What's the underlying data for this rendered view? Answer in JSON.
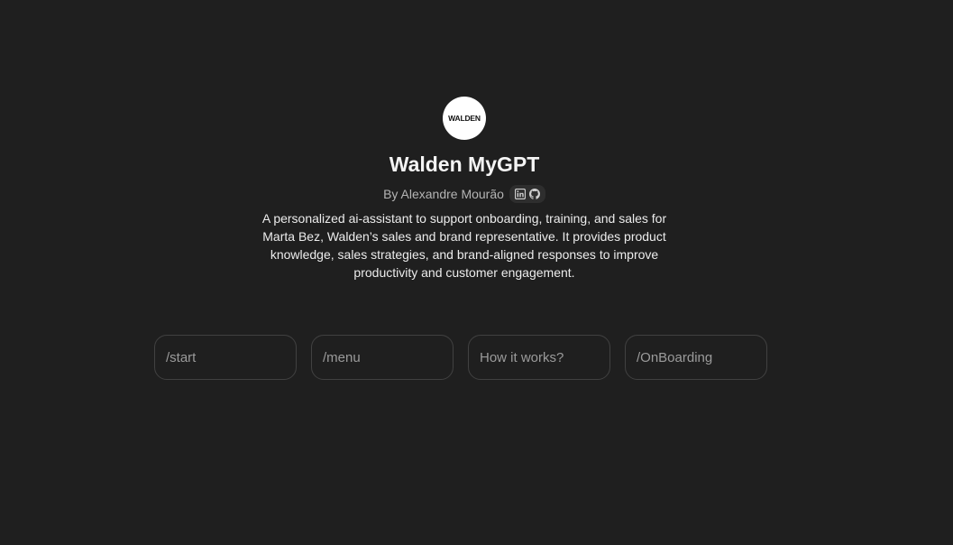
{
  "gpt": {
    "logo_text": "WALDEN",
    "title": "Walden MyGPT",
    "byline": "By Alexandre Mourão",
    "socials": [
      "linkedin-icon",
      "github-icon"
    ],
    "description": "A personalized ai-assistant to support onboarding, training, and sales for Marta Bez, Walden’s sales and brand representative. It provides product knowledge, sales strategies, and brand-aligned responses to improve productivity and customer engagement."
  },
  "starters": [
    {
      "label": "/start"
    },
    {
      "label": "/menu"
    },
    {
      "label": "How it works?"
    },
    {
      "label": "/OnBoarding"
    }
  ],
  "colors": {
    "background": "#1f1f1f",
    "chip_border": "#414141",
    "text": "#ececec",
    "muted": "#b4b4b4"
  }
}
